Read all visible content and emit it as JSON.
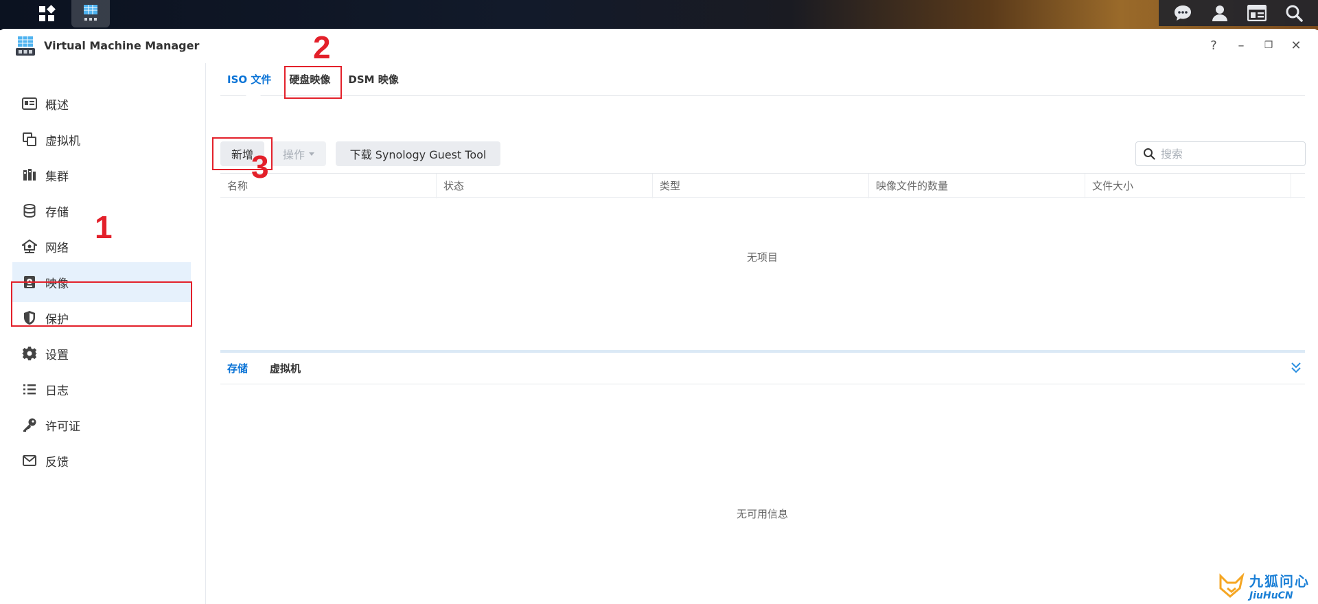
{
  "app": {
    "title": "Virtual Machine Manager"
  },
  "window_controls": {
    "help": "?",
    "minimize": "–",
    "restore": "❐",
    "close": "✕"
  },
  "sidebar": {
    "items": [
      {
        "label": "概述",
        "icon": "overview-icon"
      },
      {
        "label": "虚拟机",
        "icon": "vm-icon"
      },
      {
        "label": "集群",
        "icon": "cluster-icon"
      },
      {
        "label": "存储",
        "icon": "storage-icon"
      },
      {
        "label": "网络",
        "icon": "network-icon"
      },
      {
        "label": "映像",
        "icon": "image-icon",
        "active": true
      },
      {
        "label": "保护",
        "icon": "shield-icon"
      },
      {
        "label": "设置",
        "icon": "gear-icon"
      },
      {
        "label": "日志",
        "icon": "log-icon"
      },
      {
        "label": "许可证",
        "icon": "key-icon"
      },
      {
        "label": "反馈",
        "icon": "mail-icon"
      }
    ]
  },
  "tabs": [
    {
      "label": "ISO 文件",
      "active": true
    },
    {
      "label": "硬盘映像"
    },
    {
      "label": "DSM 映像"
    }
  ],
  "toolbar": {
    "create": "新增",
    "action": "操作",
    "download": "下载 Synology Guest Tool"
  },
  "search": {
    "placeholder": "搜索"
  },
  "table": {
    "columns": [
      "名称",
      "状态",
      "类型",
      "映像文件的数量",
      "文件大小"
    ],
    "empty": "无项目"
  },
  "bottom_tabs": [
    {
      "label": "存储",
      "active": true
    },
    {
      "label": "虚拟机"
    }
  ],
  "bottom_empty": "无可用信息",
  "annotations": [
    "1",
    "2",
    "3"
  ],
  "watermark": {
    "cn": "九狐问心",
    "en": "JiuHuCN"
  },
  "colors": {
    "accent": "#0a73d6",
    "highlight": "#e3202a",
    "active_bg": "#e6f1fc"
  }
}
